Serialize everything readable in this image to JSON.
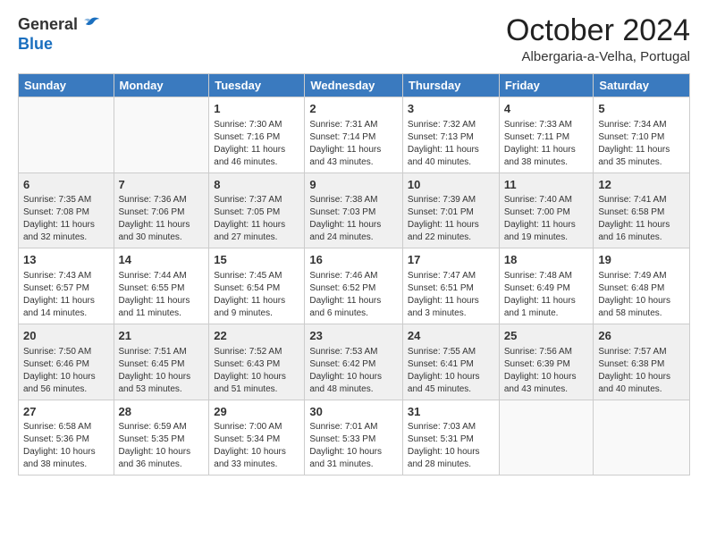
{
  "header": {
    "logo_line1": "General",
    "logo_line2": "Blue",
    "month_title": "October 2024",
    "location": "Albergaria-a-Velha, Portugal"
  },
  "weekdays": [
    "Sunday",
    "Monday",
    "Tuesday",
    "Wednesday",
    "Thursday",
    "Friday",
    "Saturday"
  ],
  "weeks": [
    [
      {
        "day": "",
        "info": ""
      },
      {
        "day": "",
        "info": ""
      },
      {
        "day": "1",
        "info": "Sunrise: 7:30 AM\nSunset: 7:16 PM\nDaylight: 11 hours and 46 minutes."
      },
      {
        "day": "2",
        "info": "Sunrise: 7:31 AM\nSunset: 7:14 PM\nDaylight: 11 hours and 43 minutes."
      },
      {
        "day": "3",
        "info": "Sunrise: 7:32 AM\nSunset: 7:13 PM\nDaylight: 11 hours and 40 minutes."
      },
      {
        "day": "4",
        "info": "Sunrise: 7:33 AM\nSunset: 7:11 PM\nDaylight: 11 hours and 38 minutes."
      },
      {
        "day": "5",
        "info": "Sunrise: 7:34 AM\nSunset: 7:10 PM\nDaylight: 11 hours and 35 minutes."
      }
    ],
    [
      {
        "day": "6",
        "info": "Sunrise: 7:35 AM\nSunset: 7:08 PM\nDaylight: 11 hours and 32 minutes."
      },
      {
        "day": "7",
        "info": "Sunrise: 7:36 AM\nSunset: 7:06 PM\nDaylight: 11 hours and 30 minutes."
      },
      {
        "day": "8",
        "info": "Sunrise: 7:37 AM\nSunset: 7:05 PM\nDaylight: 11 hours and 27 minutes."
      },
      {
        "day": "9",
        "info": "Sunrise: 7:38 AM\nSunset: 7:03 PM\nDaylight: 11 hours and 24 minutes."
      },
      {
        "day": "10",
        "info": "Sunrise: 7:39 AM\nSunset: 7:01 PM\nDaylight: 11 hours and 22 minutes."
      },
      {
        "day": "11",
        "info": "Sunrise: 7:40 AM\nSunset: 7:00 PM\nDaylight: 11 hours and 19 minutes."
      },
      {
        "day": "12",
        "info": "Sunrise: 7:41 AM\nSunset: 6:58 PM\nDaylight: 11 hours and 16 minutes."
      }
    ],
    [
      {
        "day": "13",
        "info": "Sunrise: 7:43 AM\nSunset: 6:57 PM\nDaylight: 11 hours and 14 minutes."
      },
      {
        "day": "14",
        "info": "Sunrise: 7:44 AM\nSunset: 6:55 PM\nDaylight: 11 hours and 11 minutes."
      },
      {
        "day": "15",
        "info": "Sunrise: 7:45 AM\nSunset: 6:54 PM\nDaylight: 11 hours and 9 minutes."
      },
      {
        "day": "16",
        "info": "Sunrise: 7:46 AM\nSunset: 6:52 PM\nDaylight: 11 hours and 6 minutes."
      },
      {
        "day": "17",
        "info": "Sunrise: 7:47 AM\nSunset: 6:51 PM\nDaylight: 11 hours and 3 minutes."
      },
      {
        "day": "18",
        "info": "Sunrise: 7:48 AM\nSunset: 6:49 PM\nDaylight: 11 hours and 1 minute."
      },
      {
        "day": "19",
        "info": "Sunrise: 7:49 AM\nSunset: 6:48 PM\nDaylight: 10 hours and 58 minutes."
      }
    ],
    [
      {
        "day": "20",
        "info": "Sunrise: 7:50 AM\nSunset: 6:46 PM\nDaylight: 10 hours and 56 minutes."
      },
      {
        "day": "21",
        "info": "Sunrise: 7:51 AM\nSunset: 6:45 PM\nDaylight: 10 hours and 53 minutes."
      },
      {
        "day": "22",
        "info": "Sunrise: 7:52 AM\nSunset: 6:43 PM\nDaylight: 10 hours and 51 minutes."
      },
      {
        "day": "23",
        "info": "Sunrise: 7:53 AM\nSunset: 6:42 PM\nDaylight: 10 hours and 48 minutes."
      },
      {
        "day": "24",
        "info": "Sunrise: 7:55 AM\nSunset: 6:41 PM\nDaylight: 10 hours and 45 minutes."
      },
      {
        "day": "25",
        "info": "Sunrise: 7:56 AM\nSunset: 6:39 PM\nDaylight: 10 hours and 43 minutes."
      },
      {
        "day": "26",
        "info": "Sunrise: 7:57 AM\nSunset: 6:38 PM\nDaylight: 10 hours and 40 minutes."
      }
    ],
    [
      {
        "day": "27",
        "info": "Sunrise: 6:58 AM\nSunset: 5:36 PM\nDaylight: 10 hours and 38 minutes."
      },
      {
        "day": "28",
        "info": "Sunrise: 6:59 AM\nSunset: 5:35 PM\nDaylight: 10 hours and 36 minutes."
      },
      {
        "day": "29",
        "info": "Sunrise: 7:00 AM\nSunset: 5:34 PM\nDaylight: 10 hours and 33 minutes."
      },
      {
        "day": "30",
        "info": "Sunrise: 7:01 AM\nSunset: 5:33 PM\nDaylight: 10 hours and 31 minutes."
      },
      {
        "day": "31",
        "info": "Sunrise: 7:03 AM\nSunset: 5:31 PM\nDaylight: 10 hours and 28 minutes."
      },
      {
        "day": "",
        "info": ""
      },
      {
        "day": "",
        "info": ""
      }
    ]
  ]
}
